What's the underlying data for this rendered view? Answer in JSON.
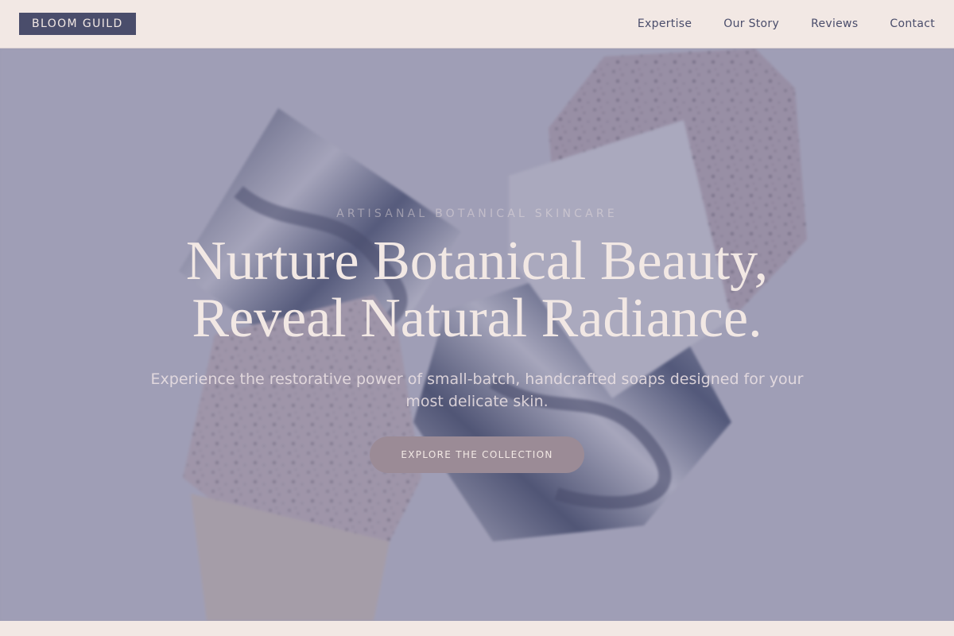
{
  "header": {
    "brand": "BLOOM GUILD",
    "nav": [
      {
        "label": "Expertise"
      },
      {
        "label": "Our Story"
      },
      {
        "label": "Reviews"
      },
      {
        "label": "Contact"
      }
    ]
  },
  "hero": {
    "eyebrow": "ARTISANAL BOTANICAL SKINCARE",
    "headline_line1": "Nurture Botanical Beauty,",
    "headline_line2": "Reveal Natural Radiance.",
    "subtext": "Experience the restorative power of small-batch, handcrafted soaps designed for your most delicate skin.",
    "cta_label": "EXPLORE THE COLLECTION",
    "image_icon": "soap-bars-photo"
  },
  "colors": {
    "background": "#f2e8e4",
    "brand_navy": "#4a4d6b",
    "overlay": "#6e6e91",
    "cta": "#9b8b96",
    "text_light": "#f2e8e4"
  }
}
